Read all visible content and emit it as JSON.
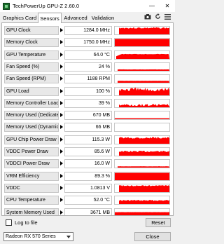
{
  "window": {
    "title": "TechPowerUp GPU-Z 2.60.0",
    "minimize": "—",
    "close": "✕"
  },
  "tabs": [
    {
      "label": "Graphics Card",
      "active": false
    },
    {
      "label": "Sensors",
      "active": true
    },
    {
      "label": "Advanced",
      "active": false
    },
    {
      "label": "Validation",
      "active": false
    }
  ],
  "tools": {
    "camera_icon": "camera-icon",
    "refresh_icon": "refresh-icon",
    "menu_icon": "hamburger-icon"
  },
  "sensors": [
    {
      "label": "GPU Clock",
      "value": "1284.0 MHz",
      "graph": "high-noisy"
    },
    {
      "label": "Memory Clock",
      "value": "1750.0 MHz",
      "graph": "full"
    },
    {
      "label": "GPU Temperature",
      "value": "64.0 °C",
      "graph": "mid-rise"
    },
    {
      "label": "Fan Speed (%)",
      "value": "24 %",
      "graph": "flat-low"
    },
    {
      "label": "Fan Speed (RPM)",
      "value": "1188 RPM",
      "graph": "flat-low-2"
    },
    {
      "label": "GPU Load",
      "value": "100 %",
      "graph": "spiky-high"
    },
    {
      "label": "Memory Controller Load",
      "value": "39 %",
      "graph": "spiky-mid"
    },
    {
      "label": "Memory Used (Dedicated)",
      "value": "670 MB",
      "graph": "line-low"
    },
    {
      "label": "Memory Used (Dynamic)",
      "value": "66 MB",
      "graph": "none"
    },
    {
      "label": "GPU Chip Power Draw",
      "value": "115.3 W",
      "graph": "high-noisy-2"
    },
    {
      "label": "VDDC Power Draw",
      "value": "85.6 W",
      "graph": "mid-noisy"
    },
    {
      "label": "VDDCI Power Draw",
      "value": "16.0 W",
      "graph": "flat-low-3"
    },
    {
      "label": "VRM Efficiency",
      "value": "89.3 %",
      "graph": "full"
    },
    {
      "label": "VDDC",
      "value": "1.0813 V",
      "graph": "high-noisy-3"
    },
    {
      "label": "CPU Temperature",
      "value": "52.0 °C",
      "graph": "mid-noisy-2"
    },
    {
      "label": "System Memory Used",
      "value": "3671 MB",
      "graph": "mid-flat"
    }
  ],
  "graph_color": "#ff0000",
  "bottom": {
    "log_label": "Log to file",
    "log_checked": false,
    "reset_label": "Reset",
    "gpu_selected": "Radeon RX 570 Series",
    "close_label": "Close"
  }
}
